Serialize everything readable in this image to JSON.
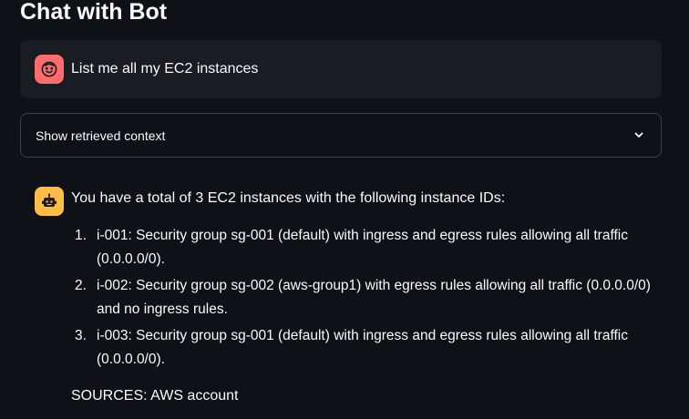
{
  "page": {
    "title": "Chat with Bot"
  },
  "user_message": {
    "avatar_icon": "user-face-icon",
    "avatar_color": "#ff6c6c",
    "text": "List me all my EC2 instances"
  },
  "expander": {
    "label": "Show retrieved context",
    "icon": "chevron-down-icon"
  },
  "bot_message": {
    "avatar_icon": "bot-icon",
    "avatar_color": "#ffbd45",
    "intro": "You have a total of 3 EC2 instances with the following instance IDs:",
    "items": [
      {
        "number": "1.",
        "text": "i-001: Security group sg-001 (default) with ingress and egress rules allowing all traffic (0.0.0.0/0)."
      },
      {
        "number": "2.",
        "text": "i-002: Security group sg-002 (aws-group1) with egress rules allowing all traffic (0.0.0.0/0) and no ingress rules."
      },
      {
        "number": "3.",
        "text": "i-003: Security group sg-001 (default) with ingress and egress rules allowing all traffic (0.0.0.0/0)."
      }
    ],
    "sources": "SOURCES: AWS account"
  }
}
